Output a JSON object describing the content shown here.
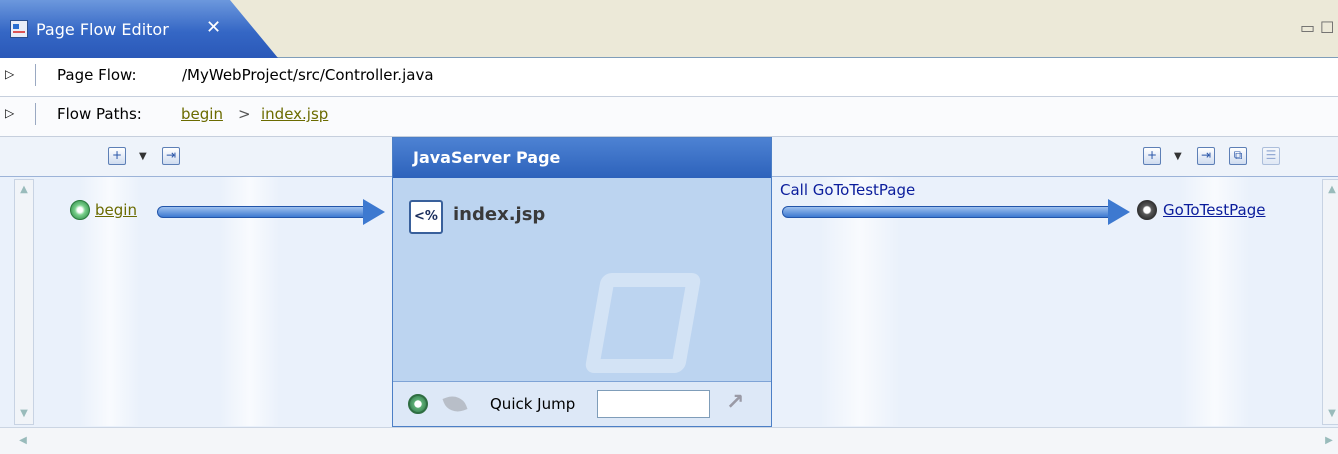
{
  "tab": {
    "title": "Page Flow Editor",
    "close": "✕"
  },
  "window_controls": {
    "minimize": "▭",
    "maximize": "☐"
  },
  "page_flow": {
    "label": "Page Flow:",
    "path": "/MyWebProject/src/Controller.java"
  },
  "flow_paths": {
    "label": "Flow Paths:",
    "crumb1": "begin",
    "sep": ">",
    "crumb2": "index.jsp"
  },
  "left_panel": {
    "node": "begin"
  },
  "center_panel": {
    "header": "JavaServer Page",
    "file": "index.jsp",
    "file_icon_text": "<%",
    "quick_jump_label": "Quick Jump",
    "quick_jump_value": ""
  },
  "right_panel": {
    "arrow_label": "Call GoToTestPage",
    "node": "GoToTestPage"
  },
  "toolbar": {
    "add": "+",
    "dropdown": "▼",
    "nav": "⇥",
    "link": "⧉",
    "props": "☰"
  }
}
